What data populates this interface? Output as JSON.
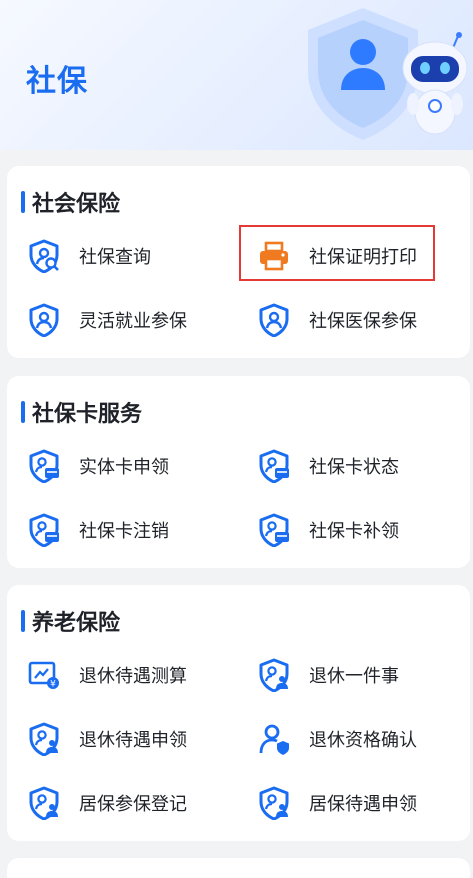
{
  "page": {
    "title": "社保"
  },
  "colors": {
    "accent": "#1a6df0",
    "highlight": "#e53935",
    "print_icon": "#f07a1f"
  },
  "sections": [
    {
      "title": "社会保险",
      "items": [
        {
          "label": "社保查询",
          "icon": "shield-search-icon"
        },
        {
          "label": "社保证明打印",
          "icon": "printer-icon"
        },
        {
          "label": "灵活就业参保",
          "icon": "shield-user-icon"
        },
        {
          "label": "社保医保参保",
          "icon": "shield-user-icon"
        }
      ]
    },
    {
      "title": "社保卡服务",
      "items": [
        {
          "label": "实体卡申领",
          "icon": "shield-card-icon"
        },
        {
          "label": "社保卡状态",
          "icon": "shield-card-icon"
        },
        {
          "label": "社保卡注销",
          "icon": "shield-card-icon"
        },
        {
          "label": "社保卡补领",
          "icon": "shield-card-icon"
        }
      ]
    },
    {
      "title": "养老保险",
      "items": [
        {
          "label": "退休待遇测算",
          "icon": "calculator-screen-icon"
        },
        {
          "label": "退休一件事",
          "icon": "shield-person-icon"
        },
        {
          "label": "退休待遇申领",
          "icon": "shield-person-icon"
        },
        {
          "label": "退休资格确认",
          "icon": "person-shield-icon"
        },
        {
          "label": "居保参保登记",
          "icon": "shield-person-icon"
        },
        {
          "label": "居保待遇申领",
          "icon": "shield-person-icon"
        }
      ]
    }
  ]
}
